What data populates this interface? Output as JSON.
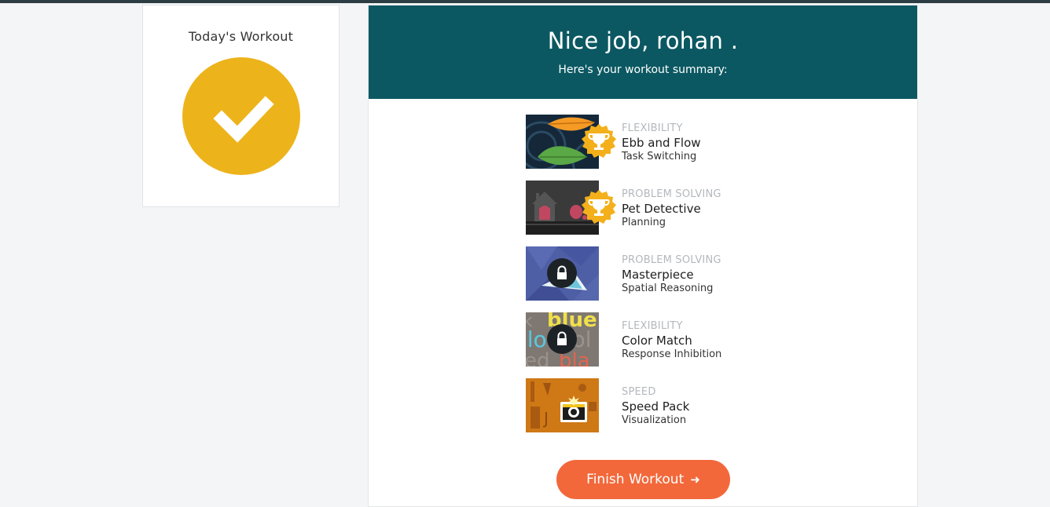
{
  "sidebar": {
    "title": "Today's Workout"
  },
  "banner": {
    "headline": "Nice job, rohan .",
    "subtitle": "Here's your workout summary:"
  },
  "games": [
    {
      "category": "FLEXIBILITY",
      "name": "Ebb and Flow",
      "skill": "Task Switching",
      "status": "trophy",
      "icon": "leaf-thumbnail"
    },
    {
      "category": "PROBLEM SOLVING",
      "name": "Pet Detective",
      "skill": "Planning",
      "status": "trophy",
      "icon": "house-thumbnail"
    },
    {
      "category": "PROBLEM SOLVING",
      "name": "Masterpiece",
      "skill": "Spatial Reasoning",
      "status": "locked",
      "icon": "puzzle-thumbnail"
    },
    {
      "category": "FLEXIBILITY",
      "name": "Color Match",
      "skill": "Response Inhibition",
      "status": "locked",
      "icon": "color-words-thumbnail",
      "thumb_words": [
        "k",
        "blue",
        "llo",
        "bl",
        "ed",
        "bla"
      ]
    },
    {
      "category": "SPEED",
      "name": "Speed Pack",
      "skill": "Visualization",
      "status": "camera",
      "icon": "camera-thumbnail",
      "thumb_letter": "J"
    }
  ],
  "finish_button": {
    "label": "Finish Workout",
    "arrow": "➜"
  },
  "colors": {
    "banner": "#0b5862",
    "check": "#edb31b",
    "button": "#f2683a",
    "trophy": "#f3b01b"
  }
}
